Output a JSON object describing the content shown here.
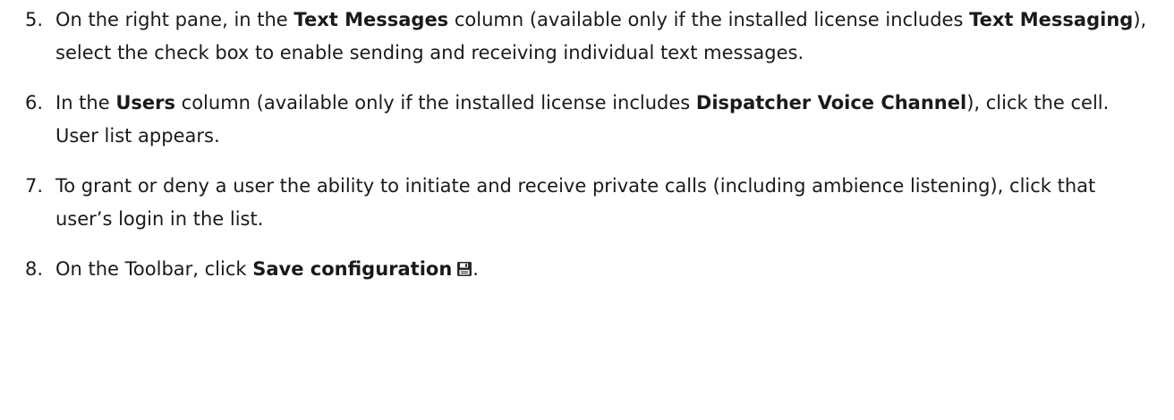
{
  "steps": [
    {
      "number": "5.",
      "t1": "On the right pane, in the ",
      "b1": "Text Messages",
      "t2": " column (available only if the installed license includes ",
      "b2": "Text Messaging",
      "t3": "), select the check box to enable sending and receiving individual text messages."
    },
    {
      "number": "6.",
      "t1": "In the ",
      "b1": "Users",
      "t2": " column (available only if the installed license includes ",
      "b2": "Dispatcher Voice Channel",
      "t3": "), click the cell.",
      "result": "User list appears."
    },
    {
      "number": "7.",
      "t1": "To grant or deny a user the ability to initiate and receive private calls (including ambience listening), click that user’s login in the list."
    },
    {
      "number": "8.",
      "t1": "On the Toolbar, click ",
      "b1": "Save configuration",
      "t2": ".",
      "icon": "save-icon"
    }
  ]
}
